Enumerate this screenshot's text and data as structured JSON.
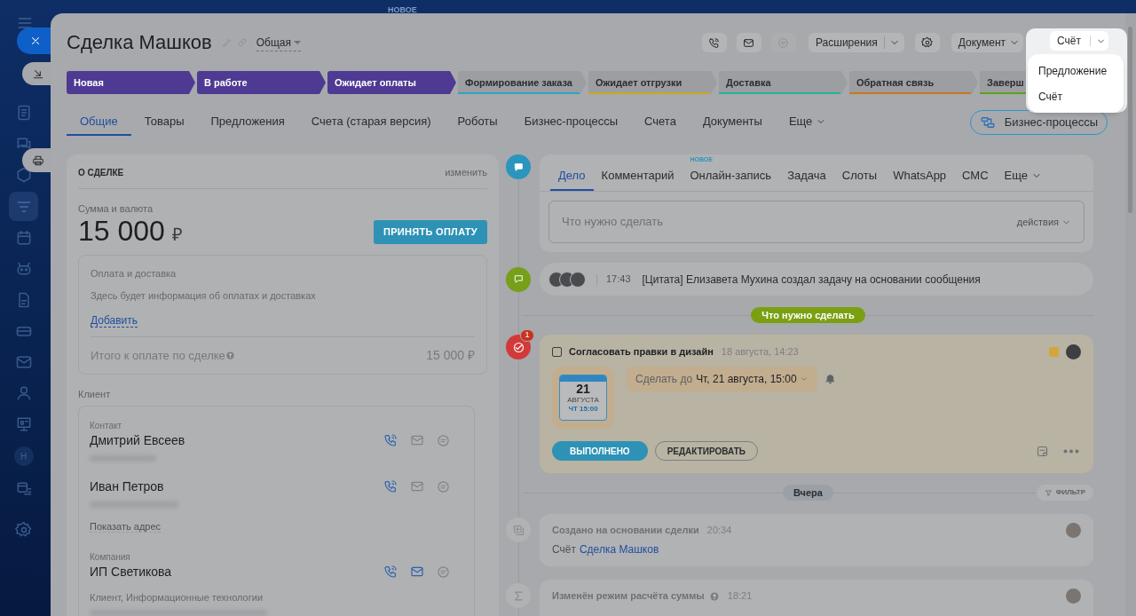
{
  "background": {
    "label": "НОВОЕ"
  },
  "sidebar": {
    "avatar_letter": "Н"
  },
  "header": {
    "title": "Сделка Машков",
    "category": "Общая",
    "extensions": "Расширения",
    "document": "Документ",
    "invoice": {
      "label": "Счёт",
      "expanded": true
    }
  },
  "invoice_menu": [
    "Предложение",
    "Счёт"
  ],
  "stages": [
    {
      "label": "Новая",
      "reached": true,
      "color": "#4e3a93"
    },
    {
      "label": "В работе",
      "reached": true,
      "color": "#4e3a93"
    },
    {
      "label": "Ожидает оплаты",
      "reached": true,
      "color": "#4e3a93"
    },
    {
      "label": "Формирование заказа",
      "reached": false,
      "color": "#2aa6c2"
    },
    {
      "label": "Ожидает отгрузки",
      "reached": false,
      "color": "#c9a81c"
    },
    {
      "label": "Доставка",
      "reached": false,
      "color": "#22b39c"
    },
    {
      "label": "Обратная связь",
      "reached": false,
      "color": "#c9781c"
    },
    {
      "label": "Заверш",
      "reached": false,
      "color": "#5aa31a"
    }
  ],
  "tabs": [
    {
      "label": "Общие",
      "selected": true
    },
    {
      "label": "Товары",
      "selected": false
    },
    {
      "label": "Предложения",
      "selected": false
    },
    {
      "label": "Счета (старая версия)",
      "selected": false
    },
    {
      "label": "Роботы",
      "selected": false
    },
    {
      "label": "Бизнес-процессы",
      "selected": false
    },
    {
      "label": "Счета",
      "selected": false
    },
    {
      "label": "Документы",
      "selected": false
    },
    {
      "label": "Еще",
      "selected": false
    }
  ],
  "process_button": "Бизнес-процессы",
  "deal": {
    "title": "О СДЕЛКЕ",
    "edit": "изменить",
    "amount_label": "Сумма и валюта",
    "amount": "15 000",
    "currency": "₽",
    "pay_button": "ПРИНЯТЬ ОПЛАТУ",
    "payment": {
      "title": "Оплата и доставка",
      "text": "Здесь будет информация об оплатах и доставках",
      "add": "Добавить",
      "total_label": "Итого к оплате по сделке",
      "total": "15 000 ₽"
    }
  },
  "client": {
    "label": "Клиент",
    "entries": [
      {
        "caption": "Контакт",
        "name": "Дмитрий Евсеев",
        "email_active": false
      },
      {
        "name": "Иван Петров",
        "link": "Показать адрес",
        "email_active": false
      },
      {
        "caption": "Компания",
        "name": "ИП Светикова",
        "detail": "Клиент, Информационные технологии",
        "email_active": true
      }
    ]
  },
  "composer": {
    "tabs": [
      {
        "label": "Дело",
        "selected": true
      },
      {
        "label": "Комментарий",
        "selected": false
      },
      {
        "label": "Онлайн-запись",
        "selected": false,
        "badge": "НОВОЕ"
      },
      {
        "label": "Задача",
        "selected": false
      },
      {
        "label": "Слоты",
        "selected": false
      },
      {
        "label": "WhatsApp",
        "selected": false
      },
      {
        "label": "СМС",
        "selected": false
      },
      {
        "label": "Еще",
        "selected": false
      }
    ],
    "placeholder": "Что нужно сделать",
    "actions": "действия"
  },
  "feed": [
    {
      "kind": "comment",
      "time": "17:43",
      "text": "[Цитата] Елизавета Мухина создал задачу на основании сообщения"
    },
    {
      "kind": "divider",
      "label": "Что нужно сделать",
      "color": "#7aa012"
    },
    {
      "kind": "task",
      "counter": "1",
      "checked": false,
      "title": "Согласовать правки в дизайн",
      "date": "18 августа, 14:23",
      "color": "#d4a53a",
      "calendar": {
        "day": "21",
        "month": "АВГУСТА",
        "sub": "ЧТ 15:00"
      },
      "deadline_label": "Сделать до",
      "deadline": "Чт, 21 августа, 15:00",
      "done": "ВЫПОЛНЕНО",
      "edit": "РЕДАКТИРОВАТЬ"
    },
    {
      "kind": "divider",
      "label": "Вчера",
      "color": "#9ba0a6",
      "filter": "ФИЛЬТР"
    },
    {
      "kind": "history",
      "title": "Создано на основании сделки",
      "time": "20:34",
      "body_label": "Счёт",
      "link": "Сделка Машков"
    },
    {
      "kind": "history",
      "title": "Изменён режим расчёта суммы",
      "time": "18:21",
      "help": true
    }
  ]
}
